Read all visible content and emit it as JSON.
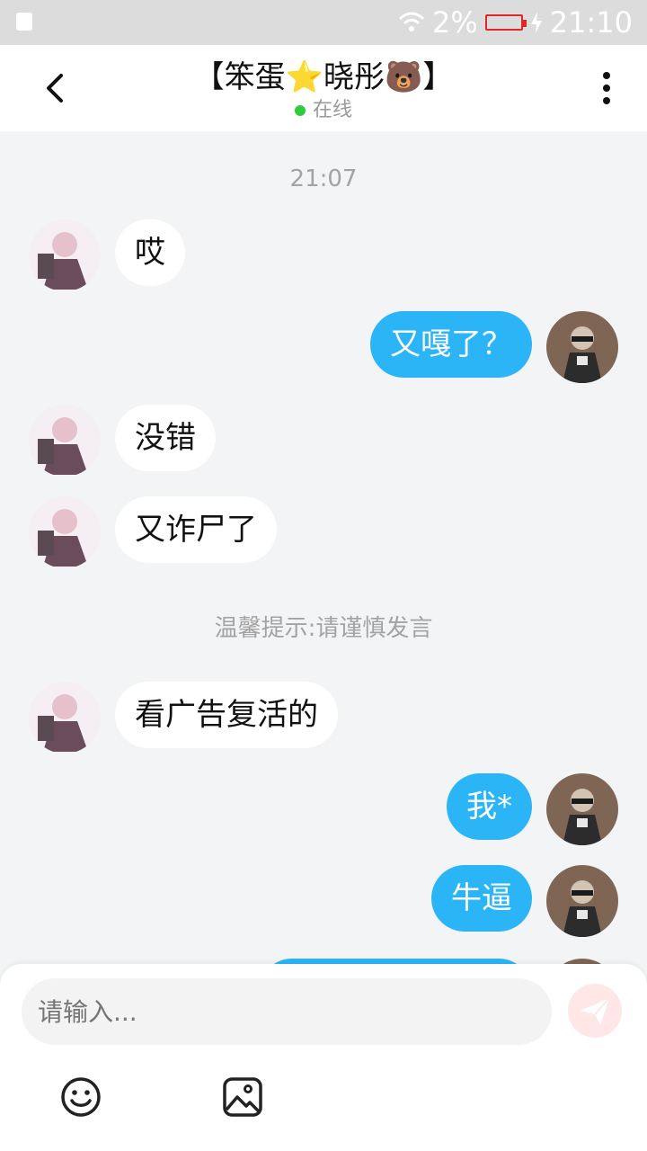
{
  "status": {
    "battery_text": "2%",
    "time": "21:10"
  },
  "chat": {
    "title": "【笨蛋⭐晓彤🐻】",
    "online": "在线",
    "time_divider": "21:07",
    "notice": "温馨提示:请谨慎发言",
    "messages": [
      {
        "side": "left",
        "text": "哎"
      },
      {
        "side": "right",
        "text": "又嘎了？"
      },
      {
        "side": "left",
        "text": "没错"
      },
      {
        "side": "left",
        "text": "又诈尸了"
      },
      {
        "side": "left",
        "text": "看广告复活的"
      },
      {
        "side": "right",
        "text": "我*"
      },
      {
        "side": "right",
        "text": "牛逼"
      }
    ]
  },
  "input": {
    "placeholder": "请输入..."
  },
  "icons": {
    "back": "chevron-left-icon",
    "more": "more-vertical-icon",
    "send": "send-icon",
    "emoji": "smile-icon",
    "image": "image-icon"
  },
  "colors": {
    "accent": "#2bb5f6",
    "online_dot": "#2ecc40",
    "battery_low": "#e02828",
    "send_disabled": "#ffe7e7"
  }
}
